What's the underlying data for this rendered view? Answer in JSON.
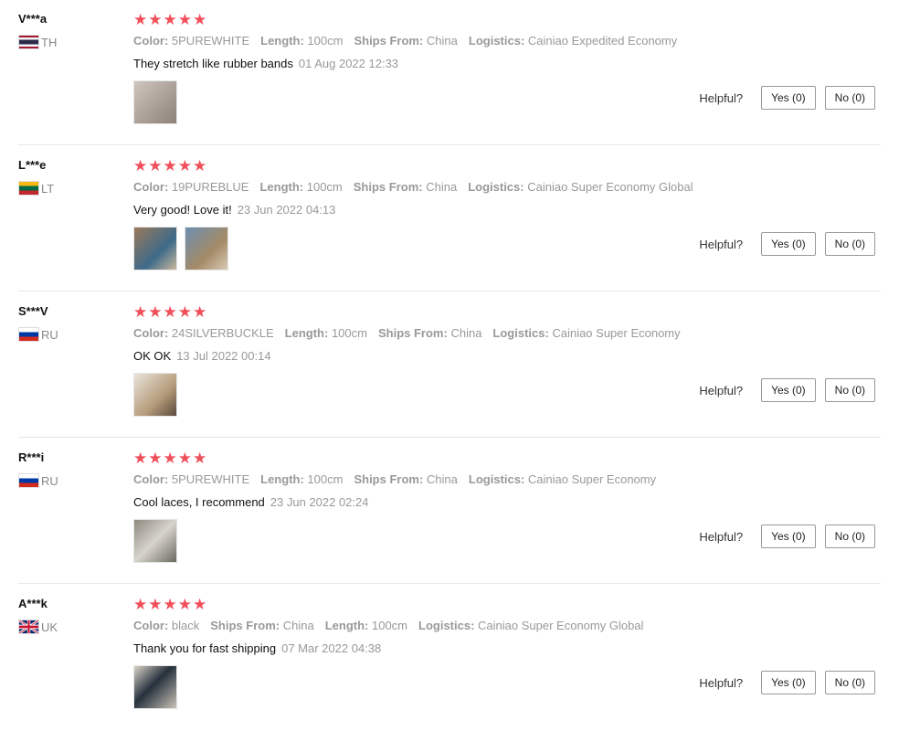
{
  "labels": {
    "helpful": "Helpful?",
    "yes": "Yes (0)",
    "no": "No (0)"
  },
  "reviews": [
    {
      "user": "V***a",
      "country": "TH",
      "flag_icon": "thailand-flag-icon",
      "stars": 5,
      "attributes": [
        {
          "key": "Color:",
          "value": "5PUREWHITE"
        },
        {
          "key": "Length:",
          "value": "100cm"
        },
        {
          "key": "Ships From:",
          "value": "China"
        },
        {
          "key": "Logistics:",
          "value": "Cainiao Expedited Economy"
        }
      ],
      "text": "They stretch like rubber bands",
      "date": "01 Aug 2022 12:33",
      "photos": 1
    },
    {
      "user": "L***e",
      "country": "LT",
      "flag_icon": "lithuania-flag-icon",
      "stars": 5,
      "attributes": [
        {
          "key": "Color:",
          "value": "19PUREBLUE"
        },
        {
          "key": "Length:",
          "value": "100cm"
        },
        {
          "key": "Ships From:",
          "value": "China"
        },
        {
          "key": "Logistics:",
          "value": "Cainiao Super Economy Global"
        }
      ],
      "text": "Very good! Love it!",
      "date": "23 Jun 2022 04:13",
      "photos": 2
    },
    {
      "user": "S***V",
      "country": "RU",
      "flag_icon": "russia-flag-icon",
      "stars": 5,
      "attributes": [
        {
          "key": "Color:",
          "value": "24SILVERBUCKLE"
        },
        {
          "key": "Length:",
          "value": "100cm"
        },
        {
          "key": "Ships From:",
          "value": "China"
        },
        {
          "key": "Logistics:",
          "value": "Cainiao Super Economy"
        }
      ],
      "text": "OK OK",
      "date": "13 Jul 2022 00:14",
      "photos": 1
    },
    {
      "user": "R***i",
      "country": "RU",
      "flag_icon": "russia-flag-icon",
      "stars": 5,
      "attributes": [
        {
          "key": "Color:",
          "value": "5PUREWHITE"
        },
        {
          "key": "Length:",
          "value": "100cm"
        },
        {
          "key": "Ships From:",
          "value": "China"
        },
        {
          "key": "Logistics:",
          "value": "Cainiao Super Economy"
        }
      ],
      "text": "Cool laces, I recommend",
      "date": "23 Jun 2022 02:24",
      "photos": 1
    },
    {
      "user": "A***k",
      "country": "UK",
      "flag_icon": "uk-flag-icon",
      "stars": 5,
      "attributes": [
        {
          "key": "Color:",
          "value": "black"
        },
        {
          "key": "Ships From:",
          "value": "China"
        },
        {
          "key": "Length:",
          "value": "100cm"
        },
        {
          "key": "Logistics:",
          "value": "Cainiao Super Economy Global"
        }
      ],
      "text": "Thank you for fast shipping",
      "date": "07 Mar 2022 04:38",
      "photos": 1
    }
  ]
}
